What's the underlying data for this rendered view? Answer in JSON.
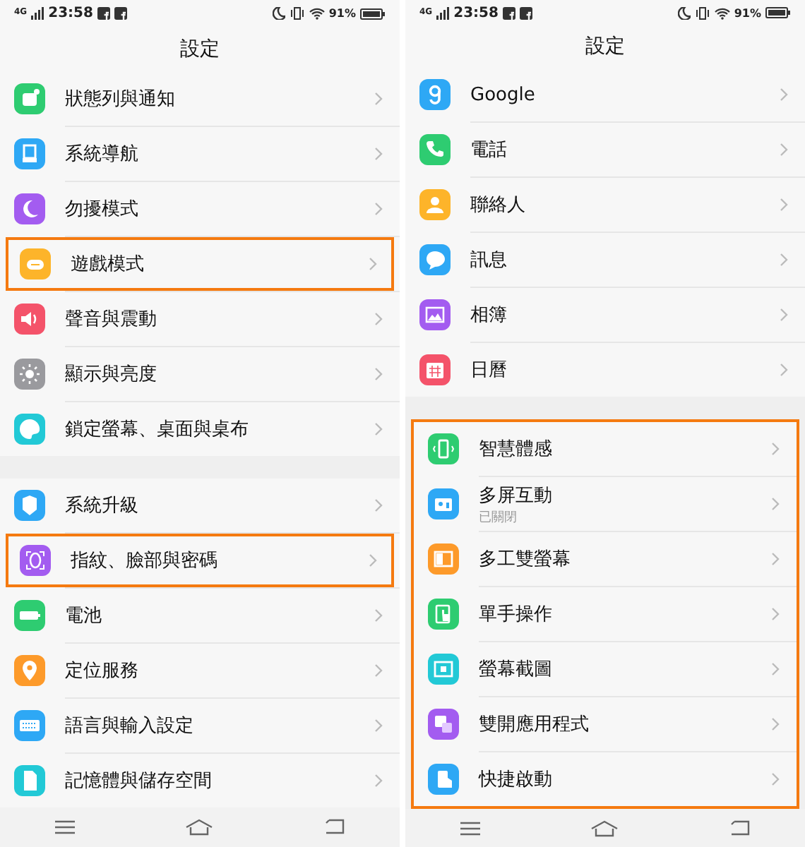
{
  "screens": [
    {
      "status_bar": {
        "network": "4G",
        "time": "23:58",
        "battery": "91%"
      },
      "title": "設定",
      "groups": [
        {
          "highlighted": false,
          "items": [
            {
              "label": "狀態列與通知",
              "color": "#2ecc71",
              "highlighted": false
            },
            {
              "label": "系統導航",
              "color": "#2ea8f5",
              "highlighted": false
            },
            {
              "label": "勿擾模式",
              "color": "#a35cf0",
              "highlighted": false
            },
            {
              "label": "遊戲模式",
              "color": "#fdb42a",
              "highlighted": true
            },
            {
              "label": "聲音與震動",
              "color": "#f4536a",
              "highlighted": false
            },
            {
              "label": "顯示與亮度",
              "color": "#9a9a9e",
              "highlighted": false
            },
            {
              "label": "鎖定螢幕、桌面與桌布",
              "color": "#22c9d6",
              "highlighted": false
            }
          ]
        },
        {
          "highlighted": false,
          "items": [
            {
              "label": "系統升級",
              "color": "#2ea8f5",
              "highlighted": false
            },
            {
              "label": "指紋、臉部與密碼",
              "color": "#a35cf0",
              "highlighted": true
            },
            {
              "label": "電池",
              "color": "#2ecc71",
              "highlighted": false
            },
            {
              "label": "定位服務",
              "color": "#fd9a2a",
              "highlighted": false
            },
            {
              "label": "語言與輸入設定",
              "color": "#2ea8f5",
              "highlighted": false
            },
            {
              "label": "記憶體與儲存空間",
              "color": "#22c9d6",
              "highlighted": false
            }
          ]
        }
      ]
    },
    {
      "status_bar": {
        "network": "4G",
        "time": "23:58",
        "battery": "91%"
      },
      "title": "設定",
      "groups": [
        {
          "highlighted": false,
          "items": [
            {
              "label": "Google",
              "color": "#2ea8f5",
              "highlighted": false
            },
            {
              "label": "電話",
              "color": "#2ecc71",
              "highlighted": false
            },
            {
              "label": "聯絡人",
              "color": "#fdb42a",
              "highlighted": false
            },
            {
              "label": "訊息",
              "color": "#2ea8f5",
              "highlighted": false
            },
            {
              "label": "相簿",
              "color": "#a35cf0",
              "highlighted": false
            },
            {
              "label": "日曆",
              "color": "#f4536a",
              "highlighted": false
            }
          ]
        },
        {
          "highlighted": true,
          "items": [
            {
              "label": "智慧體感",
              "color": "#2ecc71",
              "highlighted": false
            },
            {
              "label": "多屏互動",
              "subtitle": "已關閉",
              "color": "#2ea8f5",
              "highlighted": false
            },
            {
              "label": "多工雙螢幕",
              "color": "#fd9a2a",
              "highlighted": false
            },
            {
              "label": "單手操作",
              "color": "#2ecc71",
              "highlighted": false
            },
            {
              "label": "螢幕截圖",
              "color": "#22c9d6",
              "highlighted": false
            },
            {
              "label": "雙開應用程式",
              "color": "#a35cf0",
              "highlighted": false
            },
            {
              "label": "快捷啟動",
              "color": "#2ea8f5",
              "highlighted": false
            }
          ]
        }
      ]
    }
  ]
}
